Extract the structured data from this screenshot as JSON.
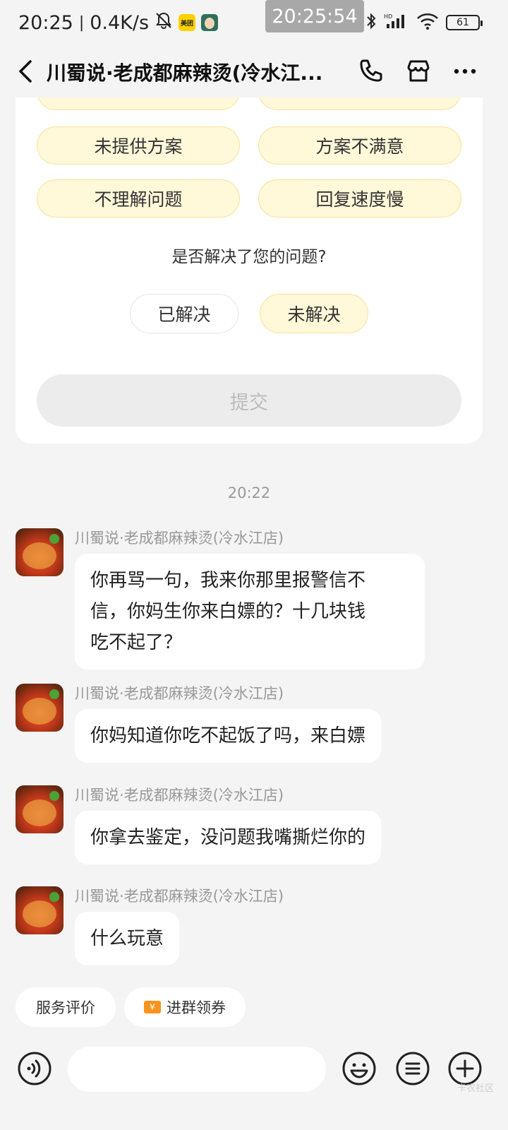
{
  "status_bar": {
    "time": "20:25",
    "speed": "0.4K/s",
    "app1": "美团",
    "clock_overlay": "20:25:54",
    "battery": "61"
  },
  "header": {
    "title": "川蜀说·老成都麻辣烫(冷水江..."
  },
  "feedback_card": {
    "chips": [
      "未提供方案",
      "方案不满意",
      "不理解问题",
      "回复速度慢"
    ],
    "question": "是否解决了您的问题?",
    "resolved_label": "已解决",
    "unresolved_label": "未解决",
    "submit_label": "提交"
  },
  "timestamp": "20:22",
  "messages": [
    {
      "sender": "川蜀说·老成都麻辣烫(冷水江店)",
      "lines": [
        "你再骂一句，我来你那里报警信不",
        "信，你妈生你来白嫖的？十几块钱",
        "吃不起了？"
      ]
    },
    {
      "sender": "川蜀说·老成都麻辣烫(冷水江店)",
      "lines": [
        "你妈知道你吃不起饭了吗，来白嫖"
      ]
    },
    {
      "sender": "川蜀说·老成都麻辣烫(冷水江店)",
      "lines": [
        "你拿去鉴定，没问题我嘴撕烂你的"
      ]
    },
    {
      "sender": "川蜀说·老成都麻辣烫(冷水江店)",
      "lines": [
        "什么玩意"
      ]
    }
  ],
  "quick_actions": {
    "rate_label": "服务评价",
    "coupon_label": "进群领券",
    "coupon_icon_text": "¥"
  },
  "watermark": "卡农社区",
  "colors": {
    "accent_chip_bg": "#fff8d9",
    "accent_chip_border": "#f6e39a",
    "page_bg": "#f4f4f4"
  }
}
